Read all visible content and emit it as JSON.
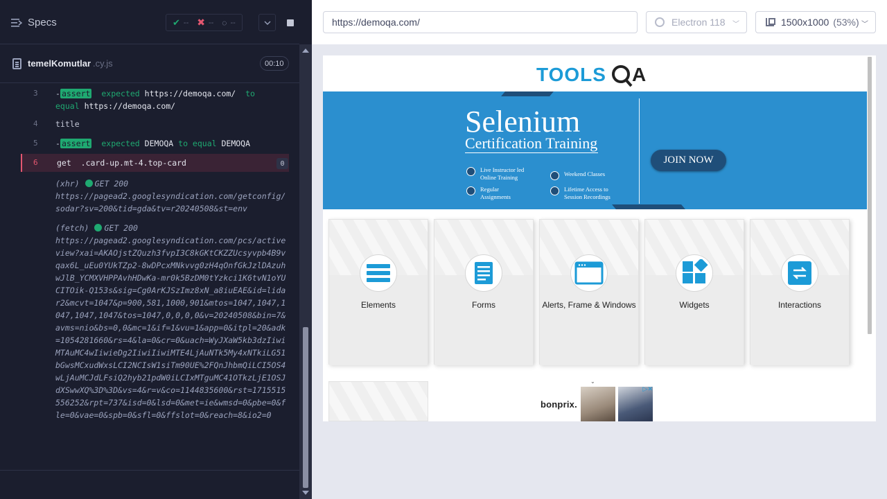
{
  "reporter": {
    "specs_label": "Specs",
    "stats": {
      "passed": "--",
      "failed": "--",
      "pending": "--"
    },
    "spec_file": {
      "name": "temelKomutlar",
      "ext": ".cy.js",
      "duration": "00:10"
    }
  },
  "log": {
    "row3": {
      "num": "3",
      "badge": "assert",
      "text1": "expected",
      "val1": "https://demoqa.com/",
      "text2": "to",
      "text3": "equal",
      "val2": "https://demoqa.com/"
    },
    "row4": {
      "num": "4",
      "text": "title"
    },
    "row5": {
      "num": "5",
      "badge": "assert",
      "text1": "expected",
      "val1": "DEMOQA",
      "text2": "to equal",
      "val2": "DEMOQA"
    },
    "row6": {
      "num": "6",
      "cmd": "get",
      "selector": ".card-up.mt-4.top-card",
      "count": "0"
    },
    "xhr": {
      "type": "(xhr)",
      "status": "GET 200",
      "url": "https://pagead2.googlesyndication.com/getconfig/sodar?sv=200&tid=gda&tv=r20240508&st=env"
    },
    "fetch": {
      "type": "(fetch)",
      "status": "GET 200",
      "url": "https://pagead2.googlesyndication.com/pcs/activeview?xai=AKAOjstZQuzh3fvpI3C8kGKtCKZZUcsyvpb4B9vqax6L_uEu0YUkTZp2-8wDPcxMNkvvg0zH4qOnfGkJzlDAzuhwJlB_YCMXVHPPAvhHDwKa-mr0k5BzDM0tYzkci1K6tvN1oYUCITOik-Q153s&sig=Cg0ArKJSzImz8xN_a8iuEAE&id=lidar2&mcvt=1047&p=900,581,1000,901&mtos=1047,1047,1047,1047,1047&tos=1047,0,0,0,0&v=20240508&bin=7&avms=nio&bs=0,0&mc=1&if=1&vu=1&app=0&itpl=20&adk=1054281660&rs=4&la=0&cr=0&uach=WyJXaW5kb3dzIiwiMTAuMC4wIiwieDg2IiwiIiwiMTE4LjAuNTk5My4xNTkiLG51bGwsMCxudWxsLCI2NCIsW1siTm90UE%2FQnJhbmQiLCI5OS4wLjAuMCJdLFsiQ2hyb21pdW0iLCIxMTguMC41OTkzLjE1OSJdXSwwXQ%3D%3D&vs=4&r=v&co=1144835600&rst=1715515556252&rpt=737&isd=0&lsd=0&met=ie&wmsd=0&pbe=0&fle=0&vae=0&spb=0&sfl=0&ffslot=0&reach=8&io2=0"
    }
  },
  "toolbar": {
    "url": "https://demoqa.com/",
    "browser": "Electron 118",
    "viewport": "1500x1000",
    "scale": "(53%)"
  },
  "aut": {
    "logo": "TOOLSQA",
    "banner": {
      "title": "Selenium",
      "subtitle": "Certification Training",
      "features": [
        "Live Instructor led Online Training",
        "Weekend Classes",
        "Regular Assignments",
        "Lifetime Access to Session Recordings"
      ],
      "cta": "JOIN NOW"
    },
    "cards": [
      "Elements",
      "Forms",
      "Alerts, Frame & Windows",
      "Widgets",
      "Interactions"
    ],
    "ad": {
      "brand": "bonprix."
    }
  },
  "colors": {
    "reporter_bg": "#1b1e2e",
    "pass": "#1fa971",
    "fail": "#e45770",
    "banner": "#2b8fcf",
    "banner_dark": "#1f4e79",
    "card_icon": "#1c9bd7"
  }
}
